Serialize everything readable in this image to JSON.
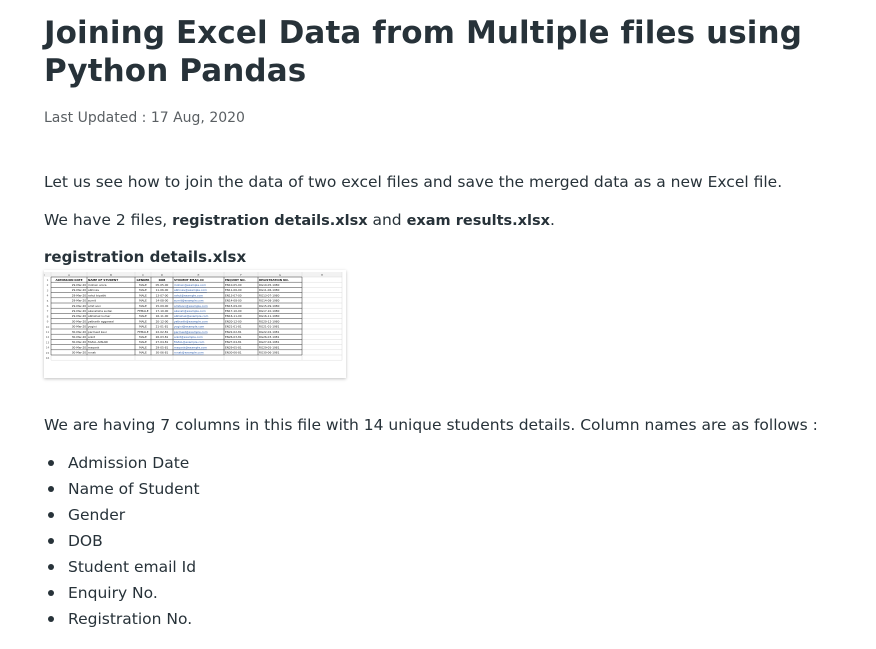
{
  "article": {
    "title": "Joining Excel Data from Multiple files using Python Pandas",
    "last_updated": "Last Updated : 17 Aug, 2020",
    "intro": "Let us see how to join the data of two excel files and save the merged  data as a new Excel file.",
    "files_prefix": "We have 2 files, ",
    "file1": "registration details.xlsx",
    "files_and": " and ",
    "file2": "exam results.xlsx",
    "files_suffix": ".",
    "section_heading": "registration details.xlsx",
    "columns_intro": "We are having 7 columns in this file with 14 unique students details. Column names are as follows :",
    "column_names": [
      "Admission Date",
      "Name of Student",
      "Gender",
      "DOB",
      "Student email Id",
      "Enquiry No.",
      "Registration No."
    ]
  },
  "spreadsheet": {
    "col_letters": [
      "A",
      "B",
      "C",
      "D",
      "E",
      "F",
      "G",
      "H",
      "I"
    ],
    "headers": [
      "ADMISSION DATE",
      "NAME OF STUDENT",
      "GENDER",
      "DOB",
      "STUDENT EMAIL ID",
      "ENQUIRY NO.",
      "REGISTRATION NO."
    ],
    "rows": [
      [
        "29-Mar-20",
        "mohsin arora",
        "MALE",
        "05-05-00",
        "mohsin@example.com",
        "EN10-05-00",
        "RG10-05-1980"
      ],
      [
        "29-Mar-20",
        "abhinav",
        "MALE",
        "11-06-00",
        "abhinav@example.com",
        "EN11-06-00",
        "RG11-06-1980"
      ],
      [
        "29-Mar-20",
        "rahul tripathi",
        "MALE",
        "13-07-00",
        "rahul@example.com",
        "EN13-07-00",
        "RG13-07-1980"
      ],
      [
        "29-Mar-20",
        "sumit",
        "MALE",
        "14-08-00",
        "sumit@example.com",
        "EN14-08-00",
        "RG14-08-1980"
      ],
      [
        "29-Mar-20",
        "amit soni",
        "MALE",
        "15-09-00",
        "amitsoni@example.com",
        "EN15-09-00",
        "RG15-09-1980"
      ],
      [
        "29-Mar-20",
        "akanshsha sudan",
        "FEMALE",
        "17-10-00",
        "akansh@example.com",
        "EN17-10-00",
        "RG17-10-1980"
      ],
      [
        "29-Mar-20",
        "abhishek kumar",
        "MALE",
        "16-11-00",
        "abhishek@example.com",
        "EN16-11-00",
        "RG16-11-1980"
      ],
      [
        "30-Mar-20",
        "yatharth aggarwal",
        "MALE",
        "20-12-00",
        "yatharth@example.com",
        "EN20-12-00",
        "RG20-12-1980"
      ],
      [
        "30-Mar-20",
        "yogini",
        "MALE",
        "21-01-81",
        "yogini@example.com",
        "EN21-01-81",
        "RG21-01-1981"
      ],
      [
        "30-Mar-20",
        "parmeet kaur",
        "FEMALE",
        "22-02-81",
        "parmeet@example.com",
        "EN22-02-81",
        "RG22-02-1981"
      ],
      [
        "30-Mar-20",
        "ankit",
        "MALE",
        "26-03-81",
        "ankit@example.com",
        "EN26-03-81",
        "RG26-03-1981"
      ],
      [
        "30-Mar-20",
        "FAZAL ANSARI",
        "MALE",
        "27-04-81",
        "FAZAL@example.com",
        "EN27-04-81",
        "RG27-04-1981"
      ],
      [
        "30-Mar-20",
        "mayank",
        "MALE",
        "29-05-81",
        "mayank@example.com",
        "EN29-05-81",
        "RG29-05-1981"
      ],
      [
        "30-Mar-20",
        "ronak",
        "MALE",
        "30-06-81",
        "ronak@example.com",
        "EN30-06-81",
        "RG30-06-1981"
      ]
    ],
    "colors": {
      "grid": "#c8c8c8",
      "border": "#333333",
      "email_link": "#2a5db0",
      "header_bg": "#f2f2f2"
    }
  }
}
